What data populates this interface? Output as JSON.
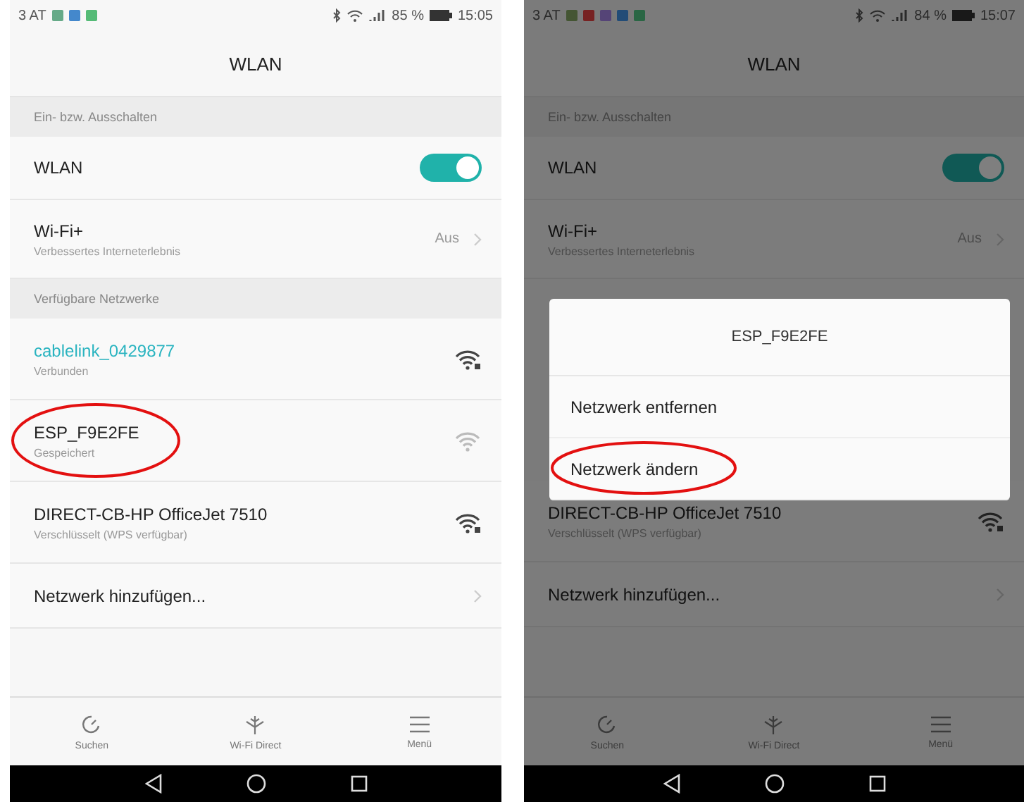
{
  "screens": [
    {
      "status_bar": {
        "carrier": "3 AT",
        "battery": "85 %",
        "time": "15:05"
      },
      "title": "WLAN",
      "sections": [
        {
          "header": "Ein- bzw. Ausschalten",
          "rows": [
            {
              "kind": "toggle",
              "title": "WLAN",
              "on": true
            },
            {
              "kind": "value",
              "title": "Wi-Fi+",
              "subtitle": "Verbessertes Interneterlebnis",
              "value": "Aus"
            }
          ]
        },
        {
          "header": "Verfügbare Netzwerke",
          "rows": [
            {
              "kind": "network",
              "title": "cablelink_0429877",
              "subtitle": "Verbunden",
              "connected": true,
              "weak_signal": false,
              "highlighted": false
            },
            {
              "kind": "network",
              "title": "ESP_F9E2FE",
              "subtitle": "Gespeichert",
              "connected": false,
              "weak_signal": true,
              "highlighted": true
            },
            {
              "kind": "network",
              "title": "DIRECT-CB-HP OfficeJet 7510",
              "subtitle": "Verschlüsselt (WPS verfügbar)",
              "connected": false,
              "weak_signal": false,
              "highlighted": false
            },
            {
              "kind": "link",
              "title": "Netzwerk hinzufügen..."
            }
          ]
        }
      ],
      "bottom_nav": [
        {
          "label": "Suchen"
        },
        {
          "label": "Wi-Fi Direct"
        },
        {
          "label": "Menü"
        }
      ]
    },
    {
      "status_bar": {
        "carrier": "3 AT",
        "battery": "84 %",
        "time": "15:07"
      },
      "title": "WLAN",
      "sections": [
        {
          "header": "Ein- bzw. Ausschalten",
          "rows": [
            {
              "kind": "toggle",
              "title": "WLAN",
              "on": true
            },
            {
              "kind": "value",
              "title": "Wi-Fi+",
              "subtitle": "Verbessertes Interneterlebnis",
              "value": "Aus"
            }
          ]
        },
        {
          "rows": [
            {
              "kind": "network",
              "title": "DIRECT-CB-HP OfficeJet 7510",
              "subtitle": "Verschlüsselt (WPS verfügbar)",
              "connected": false,
              "weak_signal": false,
              "highlighted": false
            },
            {
              "kind": "link",
              "title": "Netzwerk hinzufügen..."
            }
          ]
        }
      ],
      "bottom_nav": [
        {
          "label": "Suchen"
        },
        {
          "label": "Wi-Fi Direct"
        },
        {
          "label": "Menü"
        }
      ],
      "dialog": {
        "title": "ESP_F9E2FE",
        "options": [
          {
            "label": "Netzwerk entfernen",
            "highlighted": false
          },
          {
            "label": "Netzwerk ändern",
            "highlighted": true
          }
        ]
      }
    }
  ]
}
